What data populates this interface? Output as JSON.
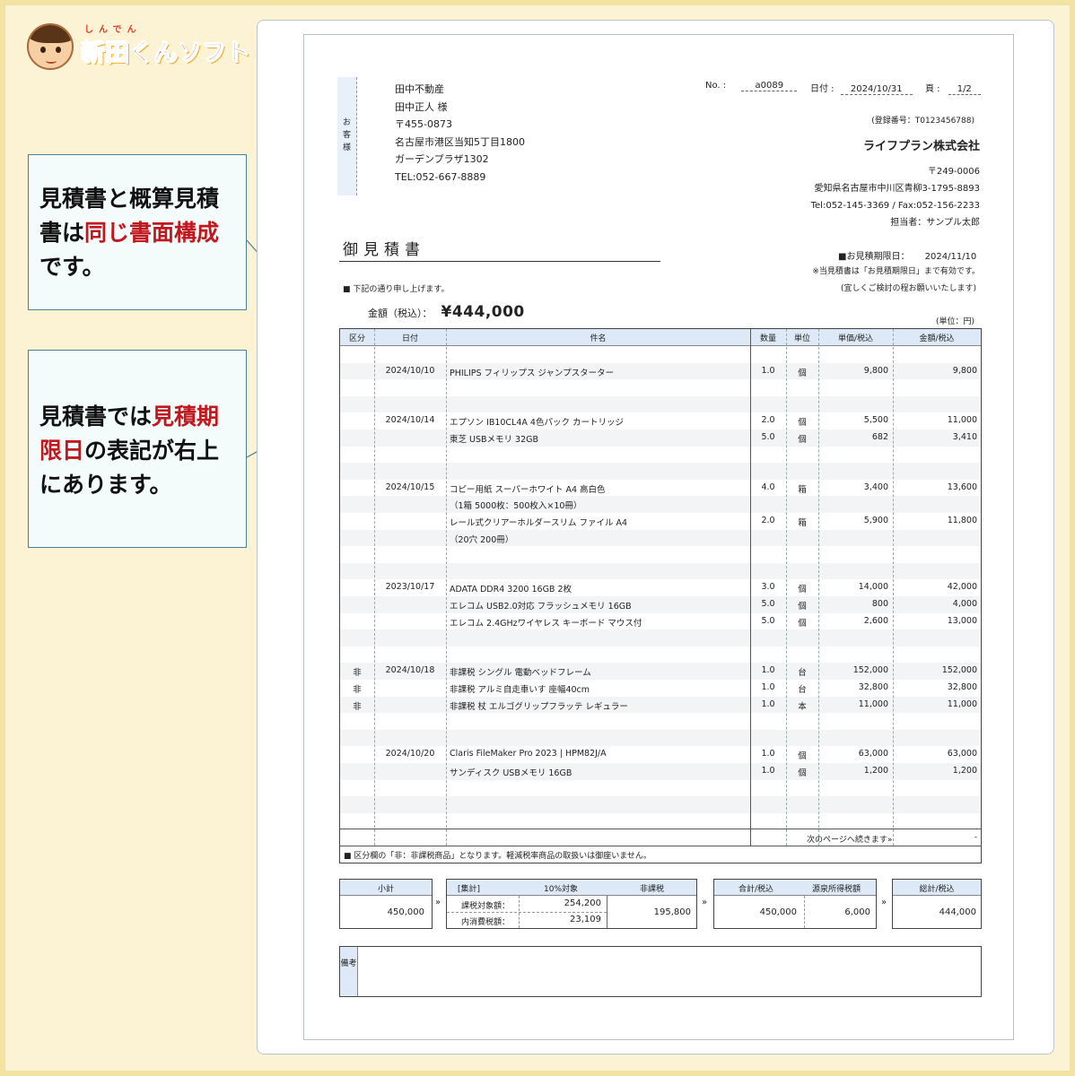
{
  "logo": {
    "ruby": "しんでん",
    "text": "新田くんソフト"
  },
  "callout1": {
    "t1": "見積書と概算見積書は",
    "t2": "同じ書面構成",
    "t3": "です。"
  },
  "callout2": {
    "t1": "見積書では",
    "t2": "見積期限日",
    "t3": "の表記が右上にあります。"
  },
  "doc": {
    "customer_label": "お客様",
    "customer": [
      "田中不動産",
      "田中正人 様",
      "〒455-0873",
      "名古屋市港区当知5丁目1800",
      "ガーデンプラザ1302",
      "TEL:052-667-8889"
    ],
    "no_label": "No. :",
    "no": "a0089",
    "date_label": "日付 :",
    "date": "2024/10/31",
    "page_label": "頁 :",
    "page": "1/2",
    "reg": "(登録番号：T0123456788)",
    "company": "ライフプラン株式会社",
    "company_info": [
      "〒249-0006",
      "愛知県名古屋市中川区青柳3-1795-8893",
      "Tel:052-145-3369 / Fax:052-156-2233",
      "担当者：サンプル太郎"
    ],
    "title": "御見積書",
    "expiry_label": "■お見積期限日：",
    "expiry": "2024/11/10",
    "expiry_note1": "※当見積書は「お見積期限日」まで有効です。",
    "expiry_note2": "(宜しくご検討の程お願いいたします)",
    "intro": "■ 下記の通り申し上げます。",
    "amount_label": "金額（税込）：",
    "amount": "¥444,000",
    "unit_note": "(単位：円)",
    "headers": [
      "区分",
      "日付",
      "件名",
      "数量",
      "単位",
      "単価/税込",
      "金額/税込"
    ],
    "rows": [
      [
        "",
        "",
        "",
        "",
        "",
        "",
        ""
      ],
      [
        "",
        "2024/10/10",
        "PHILIPS フィリップス ジャンプスターター",
        "1.0",
        "個",
        "9,800",
        "9,800"
      ],
      [
        "",
        "",
        "",
        "",
        "",
        "",
        ""
      ],
      [
        "",
        "",
        "",
        "",
        "",
        "",
        ""
      ],
      [
        "",
        "2024/10/14",
        "エプソン IB10CL4A 4色パック カートリッジ",
        "2.0",
        "個",
        "5,500",
        "11,000"
      ],
      [
        "",
        "",
        "東芝 USBメモリ 32GB",
        "5.0",
        "個",
        "682",
        "3,410"
      ],
      [
        "",
        "",
        "",
        "",
        "",
        "",
        ""
      ],
      [
        "",
        "",
        "",
        "",
        "",
        "",
        ""
      ],
      [
        "",
        "2024/10/15",
        "コピー用紙 スーパーホワイト A4 高白色",
        "4.0",
        "箱",
        "3,400",
        "13,600"
      ],
      [
        "",
        "",
        "（1箱 5000枚：500枚入×10冊）",
        "",
        "",
        "",
        ""
      ],
      [
        "",
        "",
        "レール式クリアーホルダースリム ファイル A4",
        "2.0",
        "箱",
        "5,900",
        "11,800"
      ],
      [
        "",
        "",
        "（20穴 200冊）",
        "",
        "",
        "",
        ""
      ],
      [
        "",
        "",
        "",
        "",
        "",
        "",
        ""
      ],
      [
        "",
        "",
        "",
        "",
        "",
        "",
        ""
      ],
      [
        "",
        "2023/10/17",
        "ADATA DDR4 3200 16GB 2枚",
        "3.0",
        "個",
        "14,000",
        "42,000"
      ],
      [
        "",
        "",
        "エレコム USB2.0対応 フラッシュメモリ 16GB",
        "5.0",
        "個",
        "800",
        "4,000"
      ],
      [
        "",
        "",
        "エレコム 2.4GHzワイヤレス キーボード マウス付",
        "5.0",
        "個",
        "2,600",
        "13,000"
      ],
      [
        "",
        "",
        "",
        "",
        "",
        "",
        ""
      ],
      [
        "",
        "",
        "",
        "",
        "",
        "",
        ""
      ],
      [
        "非",
        "2024/10/18",
        "非課税 シングル 電動ベッドフレーム",
        "1.0",
        "台",
        "152,000",
        "152,000"
      ],
      [
        "非",
        "",
        "非課税 アルミ自走車いす 座幅40cm",
        "1.0",
        "台",
        "32,800",
        "32,800"
      ],
      [
        "非",
        "",
        "非課税 杖 エルゴグリップフラッテ レギュラー",
        "1.0",
        "本",
        "11,000",
        "11,000"
      ],
      [
        "",
        "",
        "",
        "",
        "",
        "",
        ""
      ],
      [
        "",
        "",
        "",
        "",
        "",
        "",
        ""
      ],
      [
        "",
        "2024/10/20",
        "Claris FileMaker Pro 2023 | HPM82J/A",
        "1.0",
        "個",
        "63,000",
        "63,000"
      ],
      [
        "",
        "",
        "サンディスク USBメモリ 16GB",
        "1.0",
        "個",
        "1,200",
        "1,200"
      ],
      [
        "",
        "",
        "",
        "",
        "",
        "",
        ""
      ],
      [
        "",
        "",
        "",
        "",
        "",
        "",
        ""
      ],
      [
        "",
        "",
        "",
        "",
        "",
        "",
        ""
      ]
    ],
    "next_page": "次のページへ続きます»",
    "next_dash": "-",
    "note": "■ 区分欄の「非：非課税商品」となります。軽減税率商品の取扱いは御座いません。",
    "subtotal_label": "小計",
    "subtotal": "450,000",
    "agg_label": "[集計]",
    "tax10_label": "10%対象",
    "nontax_label": "非課税",
    "taxable_label": "課税対象額：",
    "taxable": "254,200",
    "inner_tax_label": "内消費税額：",
    "inner_tax": "23,109",
    "nontax": "195,800",
    "total_label": "合計/税込",
    "total": "450,000",
    "withhold_label": "源泉所得税額",
    "withhold": "6,000",
    "grand_label": "総計/税込",
    "grand": "444,000",
    "remarks_label": "備考"
  }
}
